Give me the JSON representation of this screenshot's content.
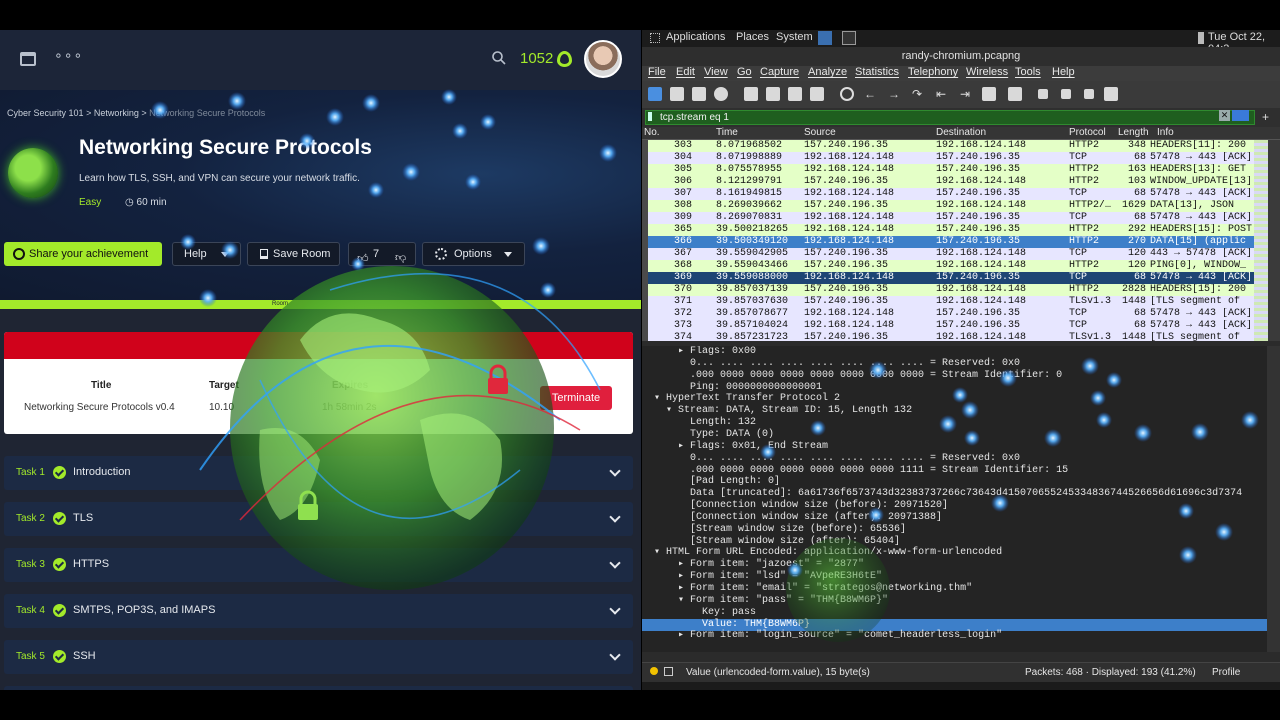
{
  "thm": {
    "points": "1052",
    "breadcrumb": [
      "Cyber Security 101",
      ">",
      "Networking",
      ">",
      "Networking Secure Protocols"
    ],
    "room_title": "Networking Secure Protocols",
    "room_desc": "Learn how TLS, SSH, and VPN can secure your network traffic.",
    "difficulty": "Easy",
    "duration": "60 min",
    "share_label": "Share your achievement",
    "help_label": "Help",
    "save_label": "Save Room",
    "likes": "7",
    "options_label": "Options",
    "progress_label": "Room",
    "machine": {
      "col_title": "Title",
      "col_target": "Target",
      "col_expires": "Expires",
      "title_value": "Networking Secure Protocols v0.4",
      "target_value": "10.10",
      "expires_value": "1h 58min 2s",
      "terminate_label": "Terminate"
    },
    "tasks": [
      {
        "num": "Task 1",
        "title": "Introduction"
      },
      {
        "num": "Task 2",
        "title": "TLS"
      },
      {
        "num": "Task 3",
        "title": "HTTPS"
      },
      {
        "num": "Task 4",
        "title": "SMTPS, POP3S, and IMAPS"
      },
      {
        "num": "Task 5",
        "title": "SSH"
      }
    ],
    "accent": "#a3ea2a"
  },
  "desktop": {
    "menus": [
      "Applications",
      "Places",
      "System"
    ],
    "clock": "Tue Oct 22, 04:3"
  },
  "wireshark": {
    "title": "randy-chromium.pcapng",
    "menu": [
      "File",
      "Edit",
      "View",
      "Go",
      "Capture",
      "Analyze",
      "Statistics",
      "Telephony",
      "Wireless",
      "Tools",
      "Help"
    ],
    "filter": "tcp.stream eq 1",
    "columns": [
      "No.",
      "Time",
      "Source",
      "Destination",
      "Protocol",
      "Length",
      "Info"
    ],
    "packets": [
      {
        "no": "303",
        "time": "8.071968502",
        "src": "157.240.196.35",
        "dst": "192.168.124.148",
        "proto": "HTTP2",
        "len": "348",
        "info": "HEADERS[11]: 200",
        "kind": "http"
      },
      {
        "no": "304",
        "time": "8.071998889",
        "src": "192.168.124.148",
        "dst": "157.240.196.35",
        "proto": "TCP",
        "len": "68",
        "info": "57478 → 443 [ACK]",
        "kind": "tcp"
      },
      {
        "no": "305",
        "time": "8.075578955",
        "src": "192.168.124.148",
        "dst": "157.240.196.35",
        "proto": "HTTP2",
        "len": "163",
        "info": "HEADERS[13]: GET",
        "kind": "http"
      },
      {
        "no": "306",
        "time": "8.121299791",
        "src": "157.240.196.35",
        "dst": "192.168.124.148",
        "proto": "HTTP2",
        "len": "103",
        "info": "WINDOW_UPDATE[13]",
        "kind": "http"
      },
      {
        "no": "307",
        "time": "8.161949815",
        "src": "192.168.124.148",
        "dst": "157.240.196.35",
        "proto": "TCP",
        "len": "68",
        "info": "57478 → 443 [ACK]",
        "kind": "tcp"
      },
      {
        "no": "308",
        "time": "8.269039662",
        "src": "157.240.196.35",
        "dst": "192.168.124.148",
        "proto": "HTTP2/…",
        "len": "1629",
        "info": "DATA[13], JSON",
        "kind": "http"
      },
      {
        "no": "309",
        "time": "8.269070831",
        "src": "192.168.124.148",
        "dst": "157.240.196.35",
        "proto": "TCP",
        "len": "68",
        "info": "57478 → 443 [ACK]",
        "kind": "tcp"
      },
      {
        "no": "365",
        "time": "39.500218265",
        "src": "192.168.124.148",
        "dst": "157.240.196.35",
        "proto": "HTTP2",
        "len": "292",
        "info": "HEADERS[15]: POST",
        "kind": "http"
      },
      {
        "no": "366",
        "time": "39.500349120",
        "src": "192.168.124.148",
        "dst": "157.240.196.35",
        "proto": "HTTP2",
        "len": "270",
        "info": "DATA[15] (applic",
        "kind": "sel"
      },
      {
        "no": "367",
        "time": "39.559042905",
        "src": "157.240.196.35",
        "dst": "192.168.124.148",
        "proto": "TCP",
        "len": "120",
        "info": "443 → 57478 [ACK]",
        "kind": "tcp"
      },
      {
        "no": "368",
        "time": "39.559043466",
        "src": "157.240.196.35",
        "dst": "192.168.124.148",
        "proto": "HTTP2",
        "len": "120",
        "info": "PING[0], WINDOW_",
        "kind": "http"
      },
      {
        "no": "369",
        "time": "39.559088000",
        "src": "192.168.124.148",
        "dst": "157.240.196.35",
        "proto": "TCP",
        "len": "68",
        "info": "57478 → 443 [ACK]",
        "kind": "mark"
      },
      {
        "no": "370",
        "time": "39.857037139",
        "src": "157.240.196.35",
        "dst": "192.168.124.148",
        "proto": "HTTP2",
        "len": "2828",
        "info": "HEADERS[15]: 200",
        "kind": "http"
      },
      {
        "no": "371",
        "time": "39.857037630",
        "src": "157.240.196.35",
        "dst": "192.168.124.148",
        "proto": "TLSv1.3",
        "len": "1448",
        "info": "[TLS segment of",
        "kind": "tls"
      },
      {
        "no": "372",
        "time": "39.857078677",
        "src": "192.168.124.148",
        "dst": "157.240.196.35",
        "proto": "TCP",
        "len": "68",
        "info": "57478 → 443 [ACK]",
        "kind": "tcp"
      },
      {
        "no": "373",
        "time": "39.857104024",
        "src": "192.168.124.148",
        "dst": "157.240.196.35",
        "proto": "TCP",
        "len": "68",
        "info": "57478 → 443 [ACK]",
        "kind": "tcp"
      },
      {
        "no": "374",
        "time": "39.857231723",
        "src": "157.240.196.35",
        "dst": "192.168.124.148",
        "proto": "TLSv1.3",
        "len": "1448",
        "info": "[TLS segment of",
        "kind": "tls"
      }
    ],
    "details": [
      {
        "t": "      ▸ Flags: 0x00",
        "sel": false
      },
      {
        "t": "        0... .... .... .... .... .... .... .... = Reserved: 0x0",
        "sel": false
      },
      {
        "t": "        .000 0000 0000 0000 0000 0000 0000 0000 = Stream Identifier: 0",
        "sel": false
      },
      {
        "t": "        Ping: 0000000000000001",
        "sel": false
      },
      {
        "t": "  ▾ HyperText Transfer Protocol 2",
        "sel": false
      },
      {
        "t": "    ▾ Stream: DATA, Stream ID: 15, Length 132",
        "sel": false
      },
      {
        "t": "        Length: 132",
        "sel": false
      },
      {
        "t": "        Type: DATA (0)",
        "sel": false
      },
      {
        "t": "      ▸ Flags: 0x01, End Stream",
        "sel": false
      },
      {
        "t": "        0... .... .... .... .... .... .... .... = Reserved: 0x0",
        "sel": false
      },
      {
        "t": "        .000 0000 0000 0000 0000 0000 0000 1111 = Stream Identifier: 15",
        "sel": false
      },
      {
        "t": "        [Pad Length: 0]",
        "sel": false
      },
      {
        "t": "        Data [truncated]: 6a61736f6573743d32383737266c73643d415070655245334836744526656d61696c3d7374",
        "sel": false
      },
      {
        "t": "        [Connection window size (before): 20971520]",
        "sel": false
      },
      {
        "t": "        [Connection window size (after): 20971388]",
        "sel": false
      },
      {
        "t": "        [Stream window size (before): 65536]",
        "sel": false
      },
      {
        "t": "        [Stream window size (after): 65404]",
        "sel": false
      },
      {
        "t": "  ▾ HTML Form URL Encoded: application/x-www-form-urlencoded",
        "sel": false
      },
      {
        "t": "      ▸ Form item: \"jazoest\" = \"2877\"",
        "sel": false
      },
      {
        "t": "      ▸ Form item: \"lsd\" = \"AVpeRE3H6tE\"",
        "sel": false
      },
      {
        "t": "      ▸ Form item: \"email\" = \"strategos@networking.thm\"",
        "sel": false
      },
      {
        "t": "      ▾ Form item: \"pass\" = \"THM{B8WM6P}\"",
        "sel": false
      },
      {
        "t": "          Key: pass",
        "sel": false
      },
      {
        "t": "          Value: THM{B8WM6P}",
        "sel": true
      },
      {
        "t": "      ▸ Form item: \"login_source\" = \"comet_headerless_login\"",
        "sel": false
      }
    ],
    "status_left": "Value (urlencoded-form.value), 15 byte(s)",
    "status_right": "Packets: 468 · Displayed: 193 (41.2%)",
    "profile": "Profile"
  }
}
